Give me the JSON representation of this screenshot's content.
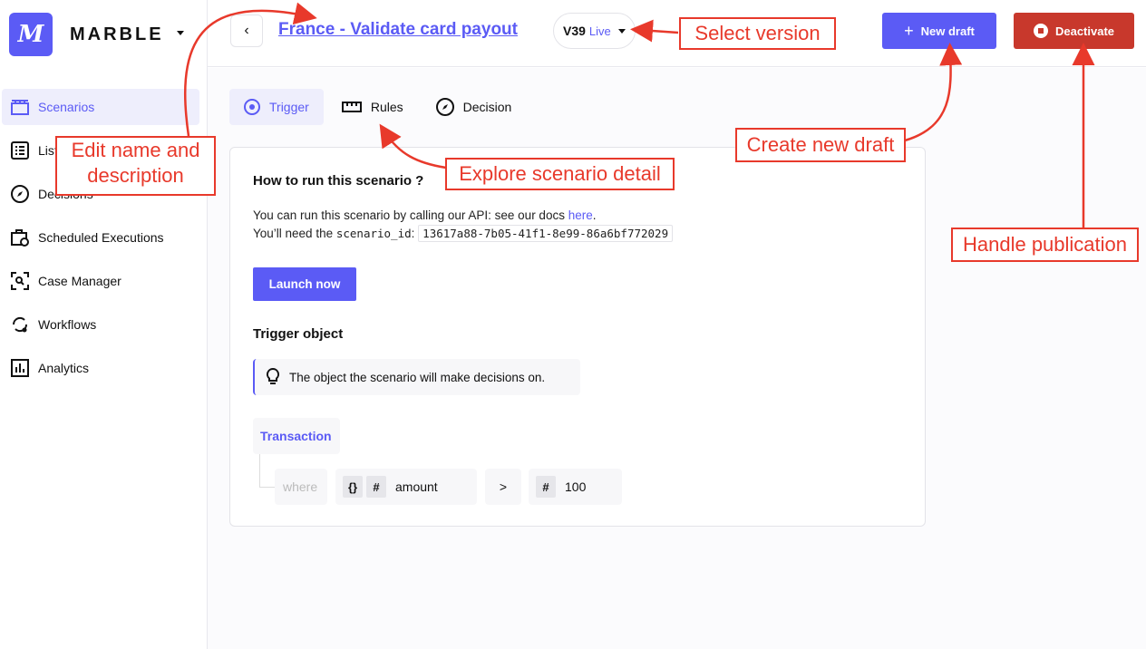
{
  "brand": {
    "name": "MARBLE",
    "logo_text": "M"
  },
  "sidebar": {
    "items": [
      {
        "label": "Scenarios",
        "icon": "clapperboard-icon",
        "active": true
      },
      {
        "label": "Lists",
        "icon": "list-icon"
      },
      {
        "label": "Decisions",
        "icon": "compass-icon"
      },
      {
        "label": "Scheduled Executions",
        "icon": "briefcase-clock-icon"
      },
      {
        "label": "Case Manager",
        "icon": "search-case-icon"
      },
      {
        "label": "Workflows",
        "icon": "workflow-icon"
      },
      {
        "label": "Analytics",
        "icon": "chart-icon"
      }
    ]
  },
  "header": {
    "back": "‹",
    "title": "France - Validate card payout",
    "version": "V39",
    "version_status": "Live",
    "new_draft": "New draft",
    "deactivate": "Deactivate"
  },
  "tabs": [
    {
      "label": "Trigger",
      "active": true
    },
    {
      "label": "Rules"
    },
    {
      "label": "Decision"
    }
  ],
  "card": {
    "title": "How to run this scenario ?",
    "line1": "You can run this scenario by calling our API: see our docs ",
    "link": "here",
    "line1_end": ".",
    "line2": "You’ll need the ",
    "code_label": "scenario_id",
    "colon": ":",
    "scenario_id": "13617a88-7b05-41f1-8e99-86a6bf772029",
    "launch": "Launch now",
    "trigger_title": "Trigger object",
    "callout": "The object the scenario will make decisions on.",
    "object": "Transaction",
    "where": "where",
    "field_tag1": "{}",
    "field_tag2": "#",
    "field": "amount",
    "operator": ">",
    "value_tag": "#",
    "value": "100"
  },
  "annotations": {
    "edit": "Edit name and description",
    "version": "Select version",
    "explore": "Explore scenario detail",
    "draft": "Create new draft",
    "publication": "Handle publication"
  },
  "colors": {
    "accent": "#5b5bf5",
    "danger": "#c8382c",
    "annotation": "#e8392b"
  }
}
